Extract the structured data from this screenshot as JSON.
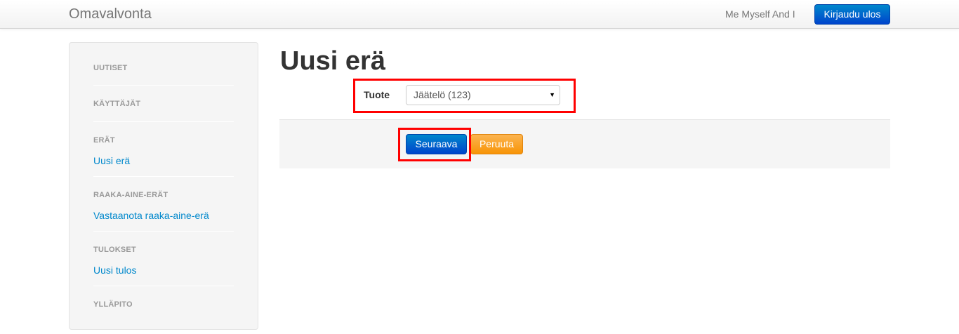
{
  "navbar": {
    "brand": "Omavalvonta",
    "user_name": "Me Myself And I",
    "logout_label": "Kirjaudu ulos"
  },
  "sidebar": {
    "sections": [
      {
        "header": "UUTISET"
      },
      {
        "header": "KÄYTTÄJÄT"
      },
      {
        "header": "ERÄT",
        "link": "Uusi erä"
      },
      {
        "header": "RAAKA-AINE-ERÄT",
        "link": "Vastaanota raaka-aine-erä"
      },
      {
        "header": "TULOKSET",
        "link": "Uusi tulos"
      },
      {
        "header": "YLLÄPITO"
      }
    ]
  },
  "main": {
    "title": "Uusi erä",
    "form": {
      "product_label": "Tuote",
      "product_selected": "Jäätelö (123)",
      "next_label": "Seuraava",
      "cancel_label": "Peruuta"
    }
  },
  "colors": {
    "primary": "#0055cc",
    "warning": "#f89406",
    "link": "#0088cc",
    "highlight": "#ff0000"
  }
}
